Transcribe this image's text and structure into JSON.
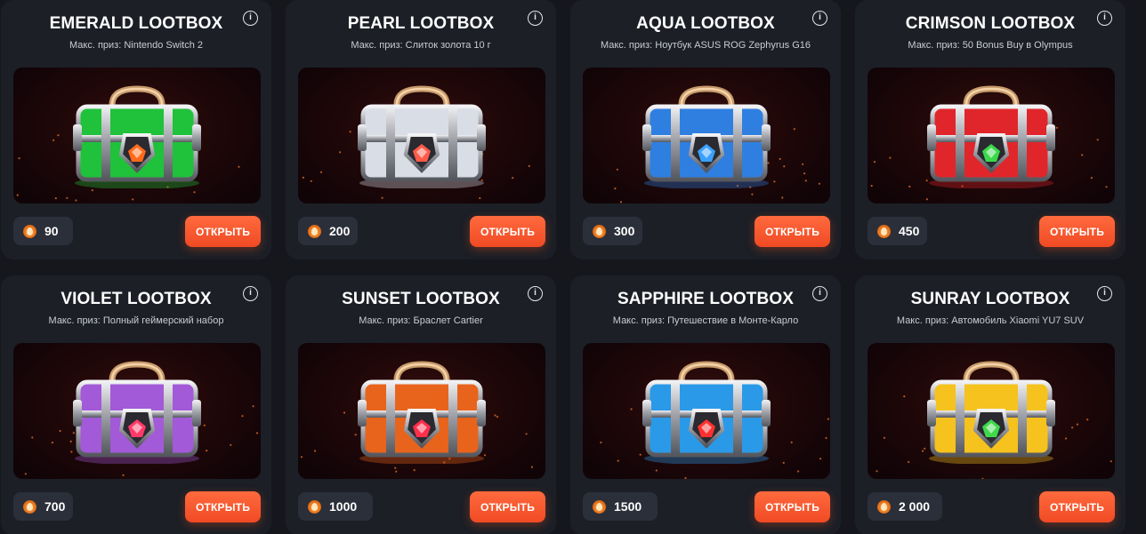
{
  "cards": [
    {
      "title": "EMERALD LOOTBOX",
      "subtitle": "Макс. приз: Nintendo Switch 2",
      "price": "90",
      "button": "ОТКРЫТЬ",
      "color": "#1fc23a",
      "gem": "#ff6a1a"
    },
    {
      "title": "PEARL LOOTBOX",
      "subtitle": "Макс. приз: Слиток золота 10 г",
      "price": "200",
      "button": "ОТКРЫТЬ",
      "color": "#d9dde6",
      "gem": "#ff5a4a"
    },
    {
      "title": "AQUA LOOTBOX",
      "subtitle": "Макс. приз: Ноутбук ASUS ROG Zephyrus G16",
      "price": "300",
      "button": "ОТКРЫТЬ",
      "color": "#2f7fe0",
      "gem": "#3aa0ff"
    },
    {
      "title": "CRIMSON LOOTBOX",
      "subtitle": "Макс. приз: 50 Bonus Buy в Olympus",
      "price": "450",
      "button": "ОТКРЫТЬ",
      "color": "#e0262b",
      "gem": "#39d94a"
    },
    {
      "title": "VIOLET LOOTBOX",
      "subtitle": "Макс. приз: Полный геймерский набор",
      "price": "700",
      "button": "ОТКРЫТЬ",
      "color": "#a25ad8",
      "gem": "#ff3a6a"
    },
    {
      "title": "SUNSET LOOTBOX",
      "subtitle": "Макс. приз: Браслет Cartier",
      "price": "1000",
      "button": "ОТКРЫТЬ",
      "color": "#e8641c",
      "gem": "#ff2e4a"
    },
    {
      "title": "SAPPHIRE LOOTBOX",
      "subtitle": "Макс. приз: Путешествие в Монте-Карло",
      "price": "1500",
      "button": "ОТКРЫТЬ",
      "color": "#2a9ae8",
      "gem": "#ff3030"
    },
    {
      "title": "SUNRAY LOOTBOX",
      "subtitle": "Макс. приз: Автомобиль Xiaomi YU7 SUV",
      "price": "2 000",
      "button": "ОТКРЫТЬ",
      "color": "#f5c21e",
      "gem": "#3fd94a"
    }
  ],
  "icons": {
    "info": "info-icon",
    "currency": "flame-coin-icon"
  },
  "info_glyph": "i",
  "accent": "#f04a24"
}
